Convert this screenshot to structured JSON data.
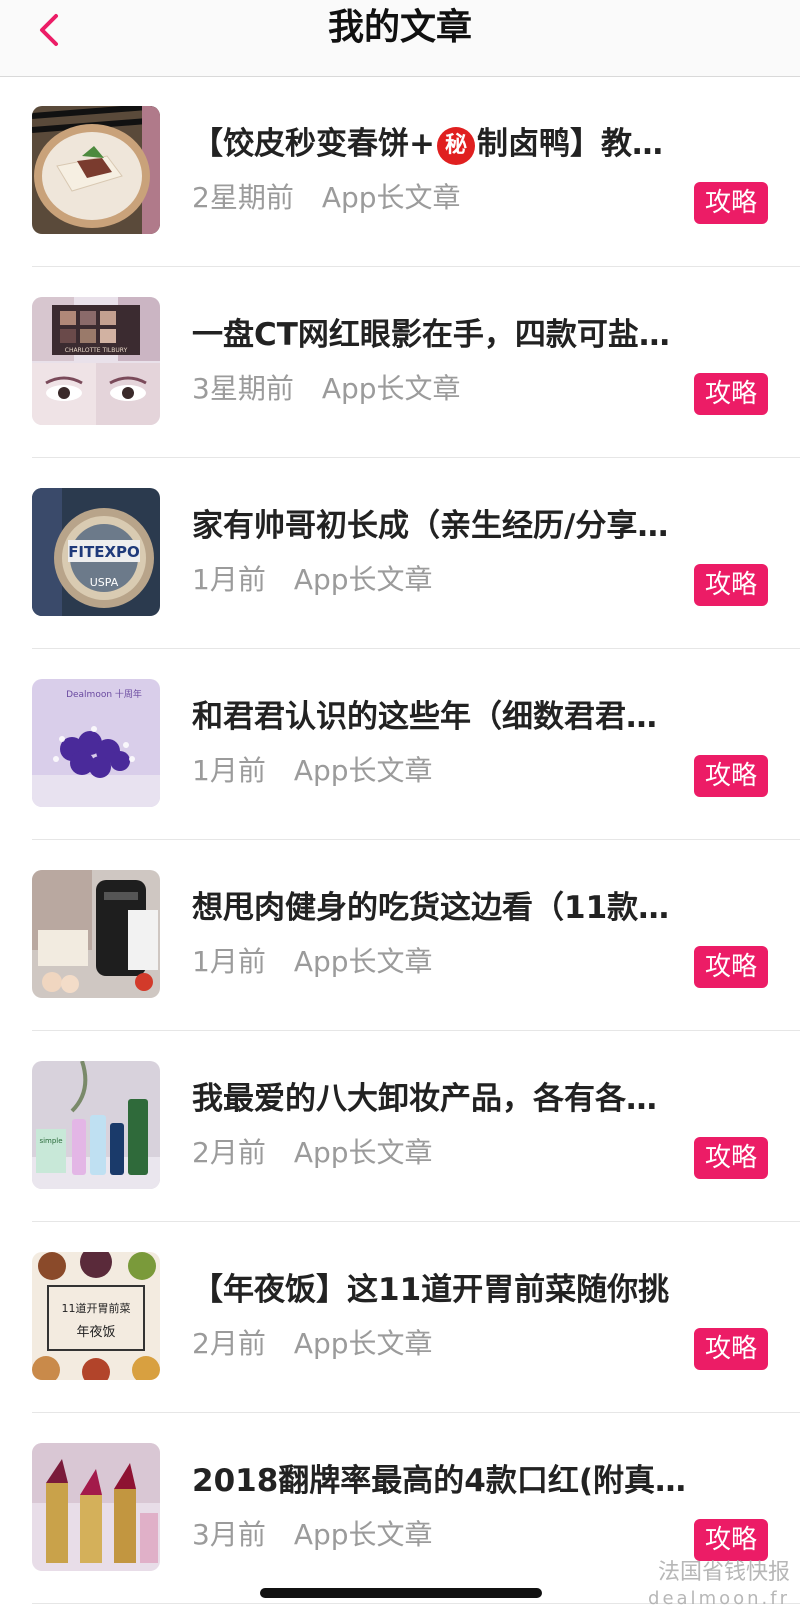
{
  "header": {
    "title": "我的文章"
  },
  "articles": [
    {
      "title_a": "【饺皮秒变春饼+",
      "badge": "秘",
      "title_b": "制卤鸭】教…",
      "time": "2星期前",
      "source": "App长文章",
      "tag": "攻略"
    },
    {
      "title": "一盘CT网红眼影在手，四款可盐…",
      "time": "3星期前",
      "source": "App长文章",
      "tag": "攻略"
    },
    {
      "title": "家有帅哥初长成（亲生经历/分享…",
      "time": "1月前",
      "source": "App长文章",
      "tag": "攻略"
    },
    {
      "title": "和君君认识的这些年（细数君君…",
      "time": "1月前",
      "source": "App长文章",
      "tag": "攻略"
    },
    {
      "title": "想甩肉健身的吃货这边看（11款…",
      "time": "1月前",
      "source": "App长文章",
      "tag": "攻略"
    },
    {
      "title": "我最爱的八大卸妆产品，各有各…",
      "time": "2月前",
      "source": "App长文章",
      "tag": "攻略"
    },
    {
      "title": "【年夜饭】这11道开胃前菜随你挑",
      "time": "2月前",
      "source": "App长文章",
      "tag": "攻略"
    },
    {
      "title": "2018翻牌率最高的4款口红(附真…",
      "time": "3月前",
      "source": "App长文章",
      "tag": "攻略"
    }
  ],
  "thumbnails": {
    "t2_text": "CHARLOTTE TILBURY",
    "t3_text": "FITEXPO",
    "t3_sub": "USPA",
    "t4_text": "Dealmoon 十周年",
    "t6_text": "simple",
    "t7_line1": "11道开胃前菜",
    "t7_line2": "年夜饭"
  },
  "watermark": {
    "line1": "法国省钱快报",
    "line2": "dealmoon.fr"
  },
  "colors": {
    "accent": "#ec1c66",
    "title": "#222222",
    "meta": "#9b9b9b"
  }
}
